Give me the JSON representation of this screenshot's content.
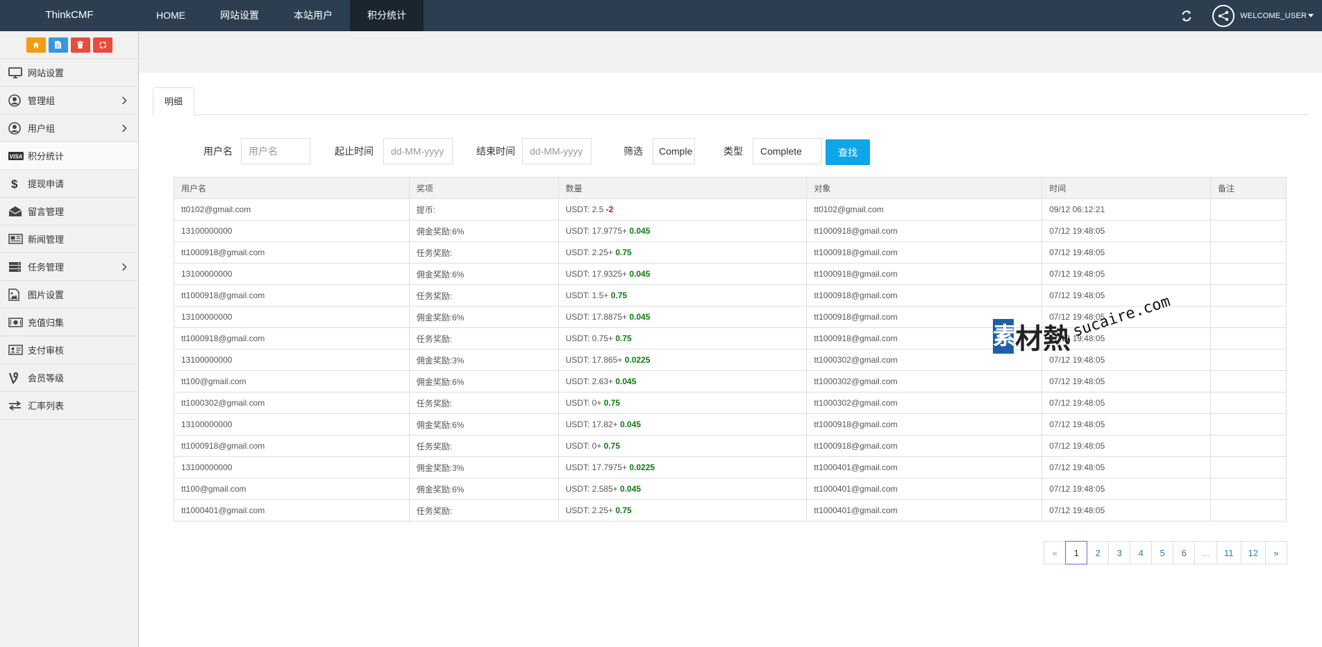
{
  "brand": "ThinkCMF",
  "nav": {
    "items": [
      {
        "label": "HOME"
      },
      {
        "label": "网站设置"
      },
      {
        "label": "本站用户"
      },
      {
        "label": "积分统计"
      }
    ],
    "active": "积分统计",
    "user": "WELCOME_USER"
  },
  "shortcuts": [
    {
      "icon": "home-icon",
      "color": "#f39c12"
    },
    {
      "icon": "file-icon",
      "color": "#3498db"
    },
    {
      "icon": "trash-icon",
      "color": "#e74c3c"
    },
    {
      "icon": "recycle-icon",
      "color": "#e74c3c"
    }
  ],
  "sidebar": {
    "items": [
      {
        "label": "网站设置",
        "icon": "monitor-icon",
        "has_children": false
      },
      {
        "label": "管理组",
        "icon": "user-circle-icon",
        "has_children": true
      },
      {
        "label": "用户组",
        "icon": "user-circle-icon",
        "has_children": true
      },
      {
        "label": "积分统计",
        "icon": "visa-icon",
        "has_children": false,
        "active": true
      },
      {
        "label": "提现申请",
        "icon": "dollar-icon",
        "has_children": false
      },
      {
        "label": "留言管理",
        "icon": "envelope-open-icon",
        "has_children": false
      },
      {
        "label": "新闻管理",
        "icon": "newspaper-icon",
        "has_children": false
      },
      {
        "label": "任务管理",
        "icon": "server-icon",
        "has_children": true
      },
      {
        "label": "图片设置",
        "icon": "image-icon",
        "has_children": false
      },
      {
        "label": "充值归集",
        "icon": "money-icon",
        "has_children": false
      },
      {
        "label": "支付审核",
        "icon": "id-card-icon",
        "has_children": false
      },
      {
        "label": "会员等级",
        "icon": "vine-icon",
        "has_children": false
      },
      {
        "label": "汇率列表",
        "icon": "exchange-icon",
        "has_children": false
      }
    ]
  },
  "tab": {
    "label": "明细"
  },
  "filters": {
    "username_label": "用户名",
    "username_placeholder": "用户名",
    "start_label": "起止时间",
    "start_placeholder": "dd-MM-yyyy",
    "end_label": "结束时间",
    "end_placeholder": "dd-MM-yyyy",
    "filter_label": "筛选",
    "filter_value": "Comple",
    "type_label": "类型",
    "type_value": "Complete",
    "search_label": "查找"
  },
  "table": {
    "headers": [
      "用户名",
      "奖项",
      "数量",
      "对象",
      "时间",
      "备注"
    ],
    "rows": [
      {
        "user": "tt0102@gmail.com",
        "award": "提币:",
        "amount": "USDT: 2.5",
        "delta": "-2",
        "sign": "minus",
        "target": "tt0102@gmail.com",
        "time": "09/12 06:12:21",
        "note": ""
      },
      {
        "user": "13100000000",
        "award": "佣金奖励:6%",
        "amount": "USDT: 17.9775+",
        "delta": "0.045",
        "sign": "plus",
        "target": "tt1000918@gmail.com",
        "time": "07/12 19:48:05",
        "note": ""
      },
      {
        "user": "tt1000918@gmail.com",
        "award": "任务奖励:",
        "amount": "USDT: 2.25+",
        "delta": "0.75",
        "sign": "plus",
        "target": "tt1000918@gmail.com",
        "time": "07/12 19:48:05",
        "note": ""
      },
      {
        "user": "13100000000",
        "award": "佣金奖励:6%",
        "amount": "USDT: 17.9325+",
        "delta": "0.045",
        "sign": "plus",
        "target": "tt1000918@gmail.com",
        "time": "07/12 19:48:05",
        "note": ""
      },
      {
        "user": "tt1000918@gmail.com",
        "award": "任务奖励:",
        "amount": "USDT: 1.5+",
        "delta": "0.75",
        "sign": "plus",
        "target": "tt1000918@gmail.com",
        "time": "07/12 19:48:05",
        "note": ""
      },
      {
        "user": "13100000000",
        "award": "佣金奖励:6%",
        "amount": "USDT: 17.8875+",
        "delta": "0.045",
        "sign": "plus",
        "target": "tt1000918@gmail.com",
        "time": "07/12 19:48:05",
        "note": ""
      },
      {
        "user": "tt1000918@gmail.com",
        "award": "任务奖励:",
        "amount": "USDT: 0.75+",
        "delta": "0.75",
        "sign": "plus",
        "target": "tt1000918@gmail.com",
        "time": "07/12 19:48:05",
        "note": ""
      },
      {
        "user": "13100000000",
        "award": "佣金奖励:3%",
        "amount": "USDT: 17.865+",
        "delta": "0.0225",
        "sign": "plus",
        "target": "tt1000302@gmail.com",
        "time": "07/12 19:48:05",
        "note": ""
      },
      {
        "user": "tt100@gmail.com",
        "award": "佣金奖励:6%",
        "amount": "USDT: 2.63+",
        "delta": "0.045",
        "sign": "plus",
        "target": "tt1000302@gmail.com",
        "time": "07/12 19:48:05",
        "note": ""
      },
      {
        "user": "tt1000302@gmail.com",
        "award": "任务奖励:",
        "amount": "USDT: 0+",
        "delta": "0.75",
        "sign": "plus",
        "target": "tt1000302@gmail.com",
        "time": "07/12 19:48:05",
        "note": ""
      },
      {
        "user": "13100000000",
        "award": "佣金奖励:6%",
        "amount": "USDT: 17.82+",
        "delta": "0.045",
        "sign": "plus",
        "target": "tt1000918@gmail.com",
        "time": "07/12 19:48:05",
        "note": ""
      },
      {
        "user": "tt1000918@gmail.com",
        "award": "任务奖励:",
        "amount": "USDT: 0+",
        "delta": "0.75",
        "sign": "plus",
        "target": "tt1000918@gmail.com",
        "time": "07/12 19:48:05",
        "note": ""
      },
      {
        "user": "13100000000",
        "award": "佣金奖励:3%",
        "amount": "USDT: 17.7975+",
        "delta": "0.0225",
        "sign": "plus",
        "target": "tt1000401@gmail.com",
        "time": "07/12 19:48:05",
        "note": ""
      },
      {
        "user": "tt100@gmail.com",
        "award": "佣金奖励:6%",
        "amount": "USDT: 2.585+",
        "delta": "0.045",
        "sign": "plus",
        "target": "tt1000401@gmail.com",
        "time": "07/12 19:48:05",
        "note": ""
      },
      {
        "user": "tt1000401@gmail.com",
        "award": "任务奖励:",
        "amount": "USDT: 2.25+",
        "delta": "0.75",
        "sign": "plus",
        "target": "tt1000401@gmail.com",
        "time": "07/12 19:48:05",
        "note": ""
      }
    ]
  },
  "pagination": {
    "prev": "«",
    "pages": [
      "1",
      "2",
      "3",
      "4",
      "5",
      "6",
      "...",
      "11",
      "12"
    ],
    "current": "1",
    "next": "»"
  },
  "watermark": {
    "text": "材熱",
    "box_char": "素",
    "url": "sucaire.com"
  }
}
